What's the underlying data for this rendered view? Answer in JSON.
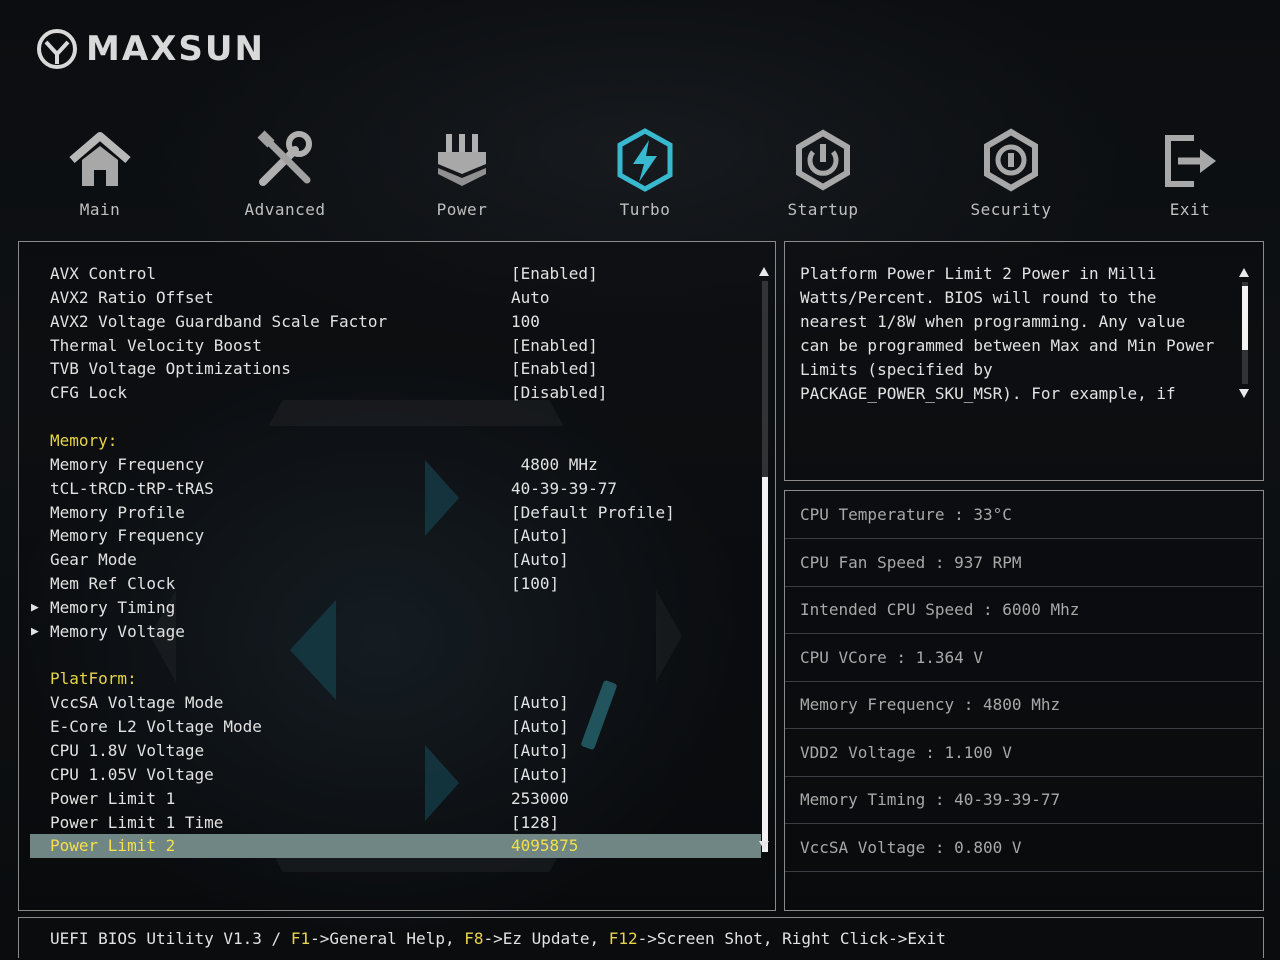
{
  "brand": {
    "name": "MAXSUN"
  },
  "nav": [
    {
      "id": "main",
      "label": "Main",
      "icon": "home-icon"
    },
    {
      "id": "advanced",
      "label": "Advanced",
      "icon": "tools-icon"
    },
    {
      "id": "power",
      "label": "Power",
      "icon": "power-chip-icon"
    },
    {
      "id": "turbo",
      "label": "Turbo",
      "icon": "lightning-icon",
      "active": true
    },
    {
      "id": "startup",
      "label": "Startup",
      "icon": "power-icon"
    },
    {
      "id": "security",
      "label": "Security",
      "icon": "shield-icon"
    },
    {
      "id": "exit",
      "label": "Exit",
      "icon": "exit-icon"
    }
  ],
  "settings": [
    {
      "name": "AVX Control",
      "value": "[Enabled]"
    },
    {
      "name": "AVX2 Ratio Offset",
      "value": "Auto"
    },
    {
      "name": "AVX2 Voltage Guardband Scale Factor",
      "value": "100"
    },
    {
      "name": "Thermal Velocity Boost",
      "value": "[Enabled]"
    },
    {
      "name": "TVB Voltage Optimizations",
      "value": "[Enabled]"
    },
    {
      "name": "CFG Lock",
      "value": "[Disabled]"
    },
    {
      "name": "",
      "value": ""
    },
    {
      "name": "Memory:",
      "value": "",
      "type": "section"
    },
    {
      "name": "Memory Frequency",
      "value": " 4800 MHz"
    },
    {
      "name": "tCL-tRCD-tRP-tRAS",
      "value": "40-39-39-77"
    },
    {
      "name": "Memory Profile",
      "value": "[Default Profile]"
    },
    {
      "name": "Memory Frequency",
      "value": "[Auto]"
    },
    {
      "name": "Gear Mode",
      "value": "[Auto]"
    },
    {
      "name": "Mem Ref Clock",
      "value": "[100]"
    },
    {
      "name": "Memory Timing",
      "value": "",
      "type": "sub"
    },
    {
      "name": "Memory Voltage",
      "value": "",
      "type": "sub"
    },
    {
      "name": "",
      "value": ""
    },
    {
      "name": "PlatForm:",
      "value": "",
      "type": "section"
    },
    {
      "name": "VccSA Voltage Mode",
      "value": "[Auto]"
    },
    {
      "name": "E-Core L2 Voltage Mode",
      "value": "[Auto]"
    },
    {
      "name": "CPU 1.8V Voltage",
      "value": "[Auto]"
    },
    {
      "name": "CPU 1.05V Voltage",
      "value": "[Auto]"
    },
    {
      "name": "Power Limit 1",
      "value": "253000"
    },
    {
      "name": "Power Limit 1 Time",
      "value": "[128]"
    },
    {
      "name": "Power Limit 2",
      "value": "4095875",
      "selected": true
    }
  ],
  "help": {
    "text": "Platform Power Limit 2 Power in Milli\nWatts/Percent. BIOS will round to the\nnearest 1/8W when programming. Any value\ncan be programmed between Max and Min Power\nLimits (specified by\nPACKAGE_POWER_SKU_MSR). For example, if"
  },
  "info": [
    "CPU Temperature : 33°C",
    "CPU Fan Speed : 937 RPM",
    "Intended CPU Speed : 6000 Mhz",
    "CPU VCore : 1.364 V",
    "Memory Frequency : 4800 Mhz",
    "VDD2 Voltage : 1.100 V",
    "Memory Timing : 40-39-39-77",
    "VccSA Voltage : 0.800 V"
  ],
  "statusbar": {
    "prefix": "UEFI BIOS Utility V1.3 / ",
    "k1": "F1",
    "t1": "->General Help, ",
    "k2": "F8",
    "t2": "->Ez Update, ",
    "k3": "F12",
    "t3": "->Screen Shot, Right Click->Exit"
  },
  "colors": {
    "accent_yellow": "#e8d44a",
    "selected_row": "#6f8685",
    "turbo_icon": "#39b9cf"
  }
}
